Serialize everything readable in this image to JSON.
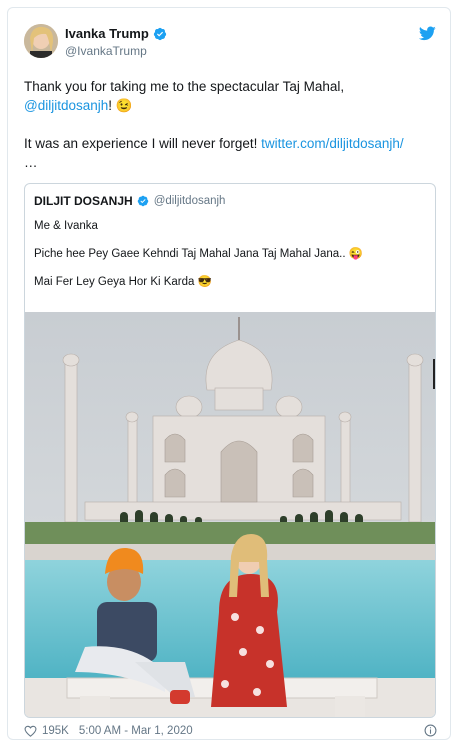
{
  "tweet": {
    "author_name": "Ivanka Trump",
    "author_handle": "@IvankaTrump",
    "line1": "Thank you for taking me to the spectacular Taj Mahal,",
    "mention": "@diljitdosanjh",
    "mention_suffix": "! 😉",
    "line2": "It was an experience I will never forget! ",
    "link": "twitter.com/diljitdosanjh/",
    "ellipsis": "…"
  },
  "quoted": {
    "author_name": "DILJIT DOSANJH",
    "author_handle": "@diljitdosanjh",
    "lines": [
      "Me & Ivanka",
      "Piche hee Pey Gaee Kehndi Taj Mahal Jana Taj Mahal Jana.. 😜",
      "Mai Fer Ley Geya Hor Ki Karda 😎"
    ]
  },
  "footer": {
    "likes": "195K",
    "timestamp": "5:00 AM - Mar 1, 2020"
  },
  "colors": {
    "link": "#1b95e0",
    "verified": "#1da1f2",
    "muted": "#657786"
  },
  "icons": {
    "bird": "twitter-bird-icon",
    "verified": "verified-badge-icon",
    "heart": "heart-icon",
    "info": "info-icon"
  }
}
